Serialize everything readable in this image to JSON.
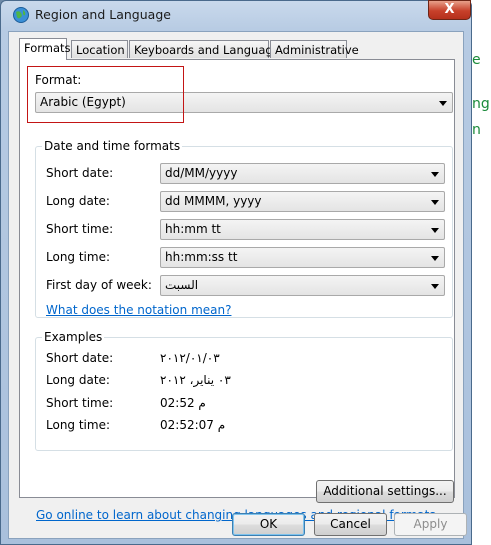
{
  "window": {
    "title": "Region and Language",
    "close_label": "X"
  },
  "background": {
    "frag1": "e",
    "frag2": "ng",
    "frag3": "n"
  },
  "tabs": [
    {
      "label": "Formats"
    },
    {
      "label": "Location"
    },
    {
      "label": "Keyboards and Languages"
    },
    {
      "label": "Administrative"
    }
  ],
  "format": {
    "label": "Format:",
    "value": "Arabic (Egypt)"
  },
  "date_time_formats": {
    "title": "Date and time formats",
    "rows": [
      {
        "label": "Short date:",
        "value": "dd/MM/yyyy"
      },
      {
        "label": "Long date:",
        "value": "dd MMMM, yyyy"
      },
      {
        "label": "Short time:",
        "value": "hh:mm tt"
      },
      {
        "label": "Long time:",
        "value": "hh:mm:ss tt"
      },
      {
        "label": "First day of week:",
        "value": "السبت"
      }
    ],
    "notation_link": "What does the notation mean?"
  },
  "examples": {
    "title": "Examples",
    "rows": [
      {
        "label": "Short date:",
        "value": "٢٠١٢/٠١/٠٣"
      },
      {
        "label": "Long date:",
        "value": "٠٣ يناير، ٢٠١٢"
      },
      {
        "label": "Short time:",
        "value": "02:52 م"
      },
      {
        "label": "Long time:",
        "value": "02:52:07 م"
      }
    ]
  },
  "additional_settings_label": "Additional settings...",
  "online_link": "Go online to learn about changing languages and regional formats",
  "buttons": {
    "ok": "OK",
    "cancel": "Cancel",
    "apply": "Apply"
  }
}
